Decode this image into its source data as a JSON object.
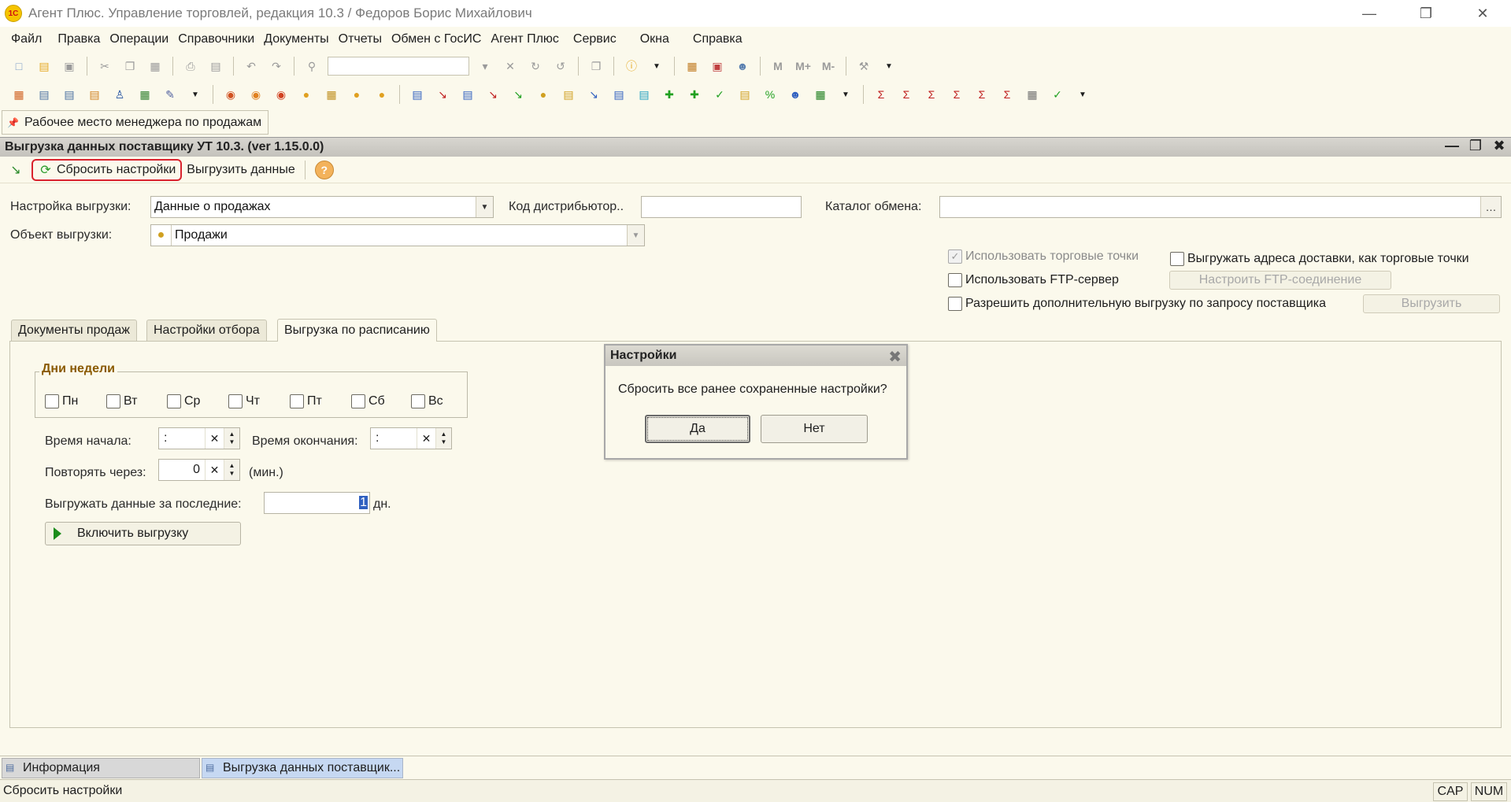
{
  "window": {
    "title": "Агент Плюс. Управление торговлей, редакция 10.3 / Федоров Борис Михайлович",
    "logo": "1С"
  },
  "menu": [
    "Файл",
    "Правка",
    "Операции",
    "Справочники",
    "Документы",
    "Отчеты",
    "Обмен с ГосИС",
    "Агент Плюс",
    "Сервис",
    "Окна",
    "Справка"
  ],
  "toolbar": {
    "memory_m": "M",
    "memory_mplus": "M+",
    "memory_mminus": "M-"
  },
  "panel": {
    "workplace_tab": "Рабочее место менеджера по продажам"
  },
  "form": {
    "title": "Выгрузка данных поставщику УТ 10.3. (ver 1.15.0.0)",
    "reset_button": "Сбросить настройки",
    "export_button": "Выгрузить данные",
    "settings_label": "Настройка выгрузки:",
    "settings_value": "Данные о продажах",
    "distributor_label": "Код дистрибьютор..",
    "distributor_value": "",
    "catalog_label": "Каталог обмена:",
    "catalog_value": "",
    "object_label": "Объект выгрузки:",
    "object_value": "Продажи",
    "use_outlets": "Использовать торговые точки",
    "export_addresses": "Выгружать адреса доставки, как торговые точки",
    "use_ftp": "Использовать FTP-сервер",
    "setup_ftp": "Настроить FTP-соединение",
    "allow_extra": "Разрешить дополнительную выгрузку по запросу поставщика",
    "extra_export_btn": "Выгрузить"
  },
  "tabs": [
    "Документы продаж",
    "Настройки отбора",
    "Выгрузка по расписанию"
  ],
  "schedule": {
    "days_title": "Дни недели",
    "days": [
      "Пн",
      "Вт",
      "Ср",
      "Чт",
      "Пт",
      "Сб",
      "Вс"
    ],
    "start_label": "Время начала:",
    "start_value": ":",
    "end_label": "Время окончания:",
    "end_value": ":",
    "repeat_label": "Повторять через:",
    "repeat_value": "0",
    "repeat_unit": "(мин.)",
    "last_days_label": "Выгружать данные за последние:",
    "last_days_value": "1",
    "last_days_unit": "дн.",
    "enable_button": "Включить выгрузку"
  },
  "dialog": {
    "title": "Настройки",
    "message": "Сбросить все ранее сохраненные настройки?",
    "yes": "Да",
    "no": "Нет"
  },
  "windows_bar": [
    "Информация",
    "Выгрузка данных поставщик..."
  ],
  "status": {
    "text": "Сбросить настройки",
    "cap": "CAP",
    "num": "NUM"
  }
}
